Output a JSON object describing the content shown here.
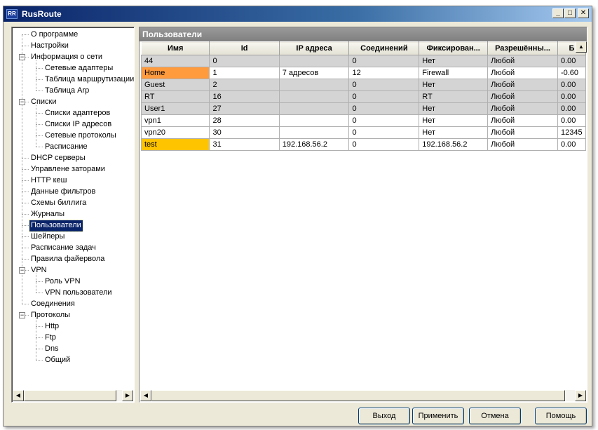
{
  "window": {
    "title": "RusRoute",
    "icon_text": "RR",
    "controls": {
      "minimize": "_",
      "maximize": "□",
      "close": "✕"
    }
  },
  "tree": {
    "nodes": [
      {
        "label": "О программе",
        "level": 0
      },
      {
        "label": "Настройки",
        "level": 0
      },
      {
        "label": "Информация о сети",
        "level": 0,
        "expander": "−"
      },
      {
        "label": "Сетевые адаптеры",
        "level": 1
      },
      {
        "label": "Таблица маршрутизации",
        "level": 1
      },
      {
        "label": "Таблица Arp",
        "level": 1
      },
      {
        "label": "Списки",
        "level": 0,
        "expander": "−"
      },
      {
        "label": "Списки адаптеров",
        "level": 1
      },
      {
        "label": "Списки IP адресов",
        "level": 1
      },
      {
        "label": "Сетевые протоколы",
        "level": 1
      },
      {
        "label": "Расписание",
        "level": 1
      },
      {
        "label": "DHCP серверы",
        "level": 0
      },
      {
        "label": "Управлене заторами",
        "level": 0
      },
      {
        "label": "HTTP кеш",
        "level": 0
      },
      {
        "label": "Данные фильтров",
        "level": 0
      },
      {
        "label": "Схемы биллига",
        "level": 0
      },
      {
        "label": "Журналы",
        "level": 0
      },
      {
        "label": "Пользователи",
        "level": 0,
        "selected": true
      },
      {
        "label": "Шейперы",
        "level": 0
      },
      {
        "label": "Расписание задач",
        "level": 0
      },
      {
        "label": "Правила файервола",
        "level": 0
      },
      {
        "label": "VPN",
        "level": 0,
        "expander": "−"
      },
      {
        "label": "Роль VPN",
        "level": 1
      },
      {
        "label": "VPN пользователи",
        "level": 1
      },
      {
        "label": "Соединения",
        "level": 0
      },
      {
        "label": "Протоколы",
        "level": 0,
        "expander": "−"
      },
      {
        "label": "Http",
        "level": 1
      },
      {
        "label": "Ftp",
        "level": 1
      },
      {
        "label": "Dns",
        "level": 1
      },
      {
        "label": "Общий",
        "level": 1
      }
    ]
  },
  "main": {
    "header": "Пользователи",
    "columns": [
      "Имя",
      "Id",
      "IP адреса",
      "Соединений",
      "Фиксирован...",
      "Разрешённы...",
      "Б"
    ],
    "rows": [
      {
        "cells": [
          "44",
          "0",
          "",
          "0",
          "Нет",
          "Любой",
          "0.00"
        ],
        "style": "gray"
      },
      {
        "cells": [
          "Home",
          "1",
          "7 адресов",
          "12",
          "Firewall",
          "Любой",
          "-0.60"
        ],
        "style": "white",
        "name_highlight": "orange"
      },
      {
        "cells": [
          "Guest",
          "2",
          "",
          "0",
          "Нет",
          "Любой",
          "0.00"
        ],
        "style": "gray"
      },
      {
        "cells": [
          "RT",
          "16",
          "",
          "0",
          "RT",
          "Любой",
          "0.00"
        ],
        "style": "gray"
      },
      {
        "cells": [
          "User1",
          "27",
          "",
          "0",
          "Нет",
          "Любой",
          "0.00"
        ],
        "style": "gray"
      },
      {
        "cells": [
          "vpn1",
          "28",
          "",
          "0",
          "Нет",
          "Любой",
          "0.00"
        ],
        "style": "white"
      },
      {
        "cells": [
          "vpn20",
          "30",
          "",
          "0",
          "Нет",
          "Любой",
          "12345"
        ],
        "style": "white"
      },
      {
        "cells": [
          "test",
          "31",
          "192.168.56.2",
          "0",
          "192.168.56.2",
          "Любой",
          "0.00"
        ],
        "style": "white",
        "name_highlight": "yellow"
      }
    ]
  },
  "buttons": {
    "exit": "Выход",
    "apply": "Применить",
    "cancel": "Отмена",
    "help": "Помощь"
  },
  "icons": {
    "scroll_left": "left-arrow-icon",
    "scroll_right": "right-arrow-icon",
    "scroll_up": "up-arrow-icon"
  },
  "colors": {
    "title_start": "#0a246a",
    "title_end": "#a6caf0",
    "selected_bg": "#0a246a",
    "highlight_orange": "#ff9a3d",
    "highlight_yellow": "#ffc400",
    "row_gray": "#d4d4d4"
  }
}
